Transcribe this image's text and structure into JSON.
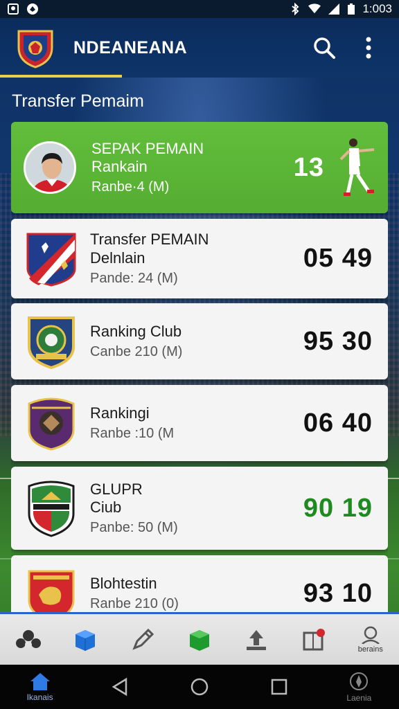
{
  "status_bar": {
    "time": "1:003",
    "icons": [
      "photo-icon",
      "notification-icon",
      "bluetooth-icon",
      "wifi-icon",
      "signal-icon",
      "battery-icon"
    ]
  },
  "app_bar": {
    "title": "NDEANEANA",
    "logo": "club-crest-logo",
    "actions": [
      "search-icon",
      "more-vert-icon"
    ]
  },
  "section": {
    "title": "Transfer Pemaim"
  },
  "cards": [
    {
      "line1": "SEPAK PEMAIN",
      "line2": "Rankain",
      "line3": "Ranbe·4 (M)",
      "score": "13",
      "featured": true
    },
    {
      "line1": "Transfer PEMAIN",
      "line2": "Delnlain",
      "line3": "Pande: 24 (M)",
      "score": "05 49"
    },
    {
      "line1": "Ranking Club",
      "line2": "",
      "line3": "Canbe 210 (M)",
      "score": "95 30"
    },
    {
      "line1": "Rankingi",
      "line2": "",
      "line3": "Ranbe :10 (M",
      "score": "06 40"
    },
    {
      "line1": "GLUPR",
      "line2": "Ciub",
      "line3": "Panbe: 50 (M)",
      "score": "90 19",
      "score_color": "#1f8a1f"
    },
    {
      "line1": "Blohtestin",
      "line2": "",
      "line3": "Ranbe 210 (0)",
      "score": "93 10"
    }
  ],
  "tab_bar": {
    "items": [
      {
        "icon": "people-icon",
        "label": ""
      },
      {
        "icon": "blue-cube-icon",
        "label": ""
      },
      {
        "icon": "pen-icon",
        "label": ""
      },
      {
        "icon": "green-cube-icon",
        "label": ""
      },
      {
        "icon": "upload-icon",
        "label": ""
      },
      {
        "icon": "notification-book-icon",
        "label": ""
      },
      {
        "icon": "profile-icon",
        "label": "berains"
      }
    ]
  },
  "system_nav": {
    "home_label": "Ikanais",
    "right_label": "Laenia"
  },
  "colors": {
    "appbar": "#0e3469",
    "featured_card": "#5cb536",
    "accent_underline": "#e6d24a",
    "tab_border": "#2a63c9"
  }
}
